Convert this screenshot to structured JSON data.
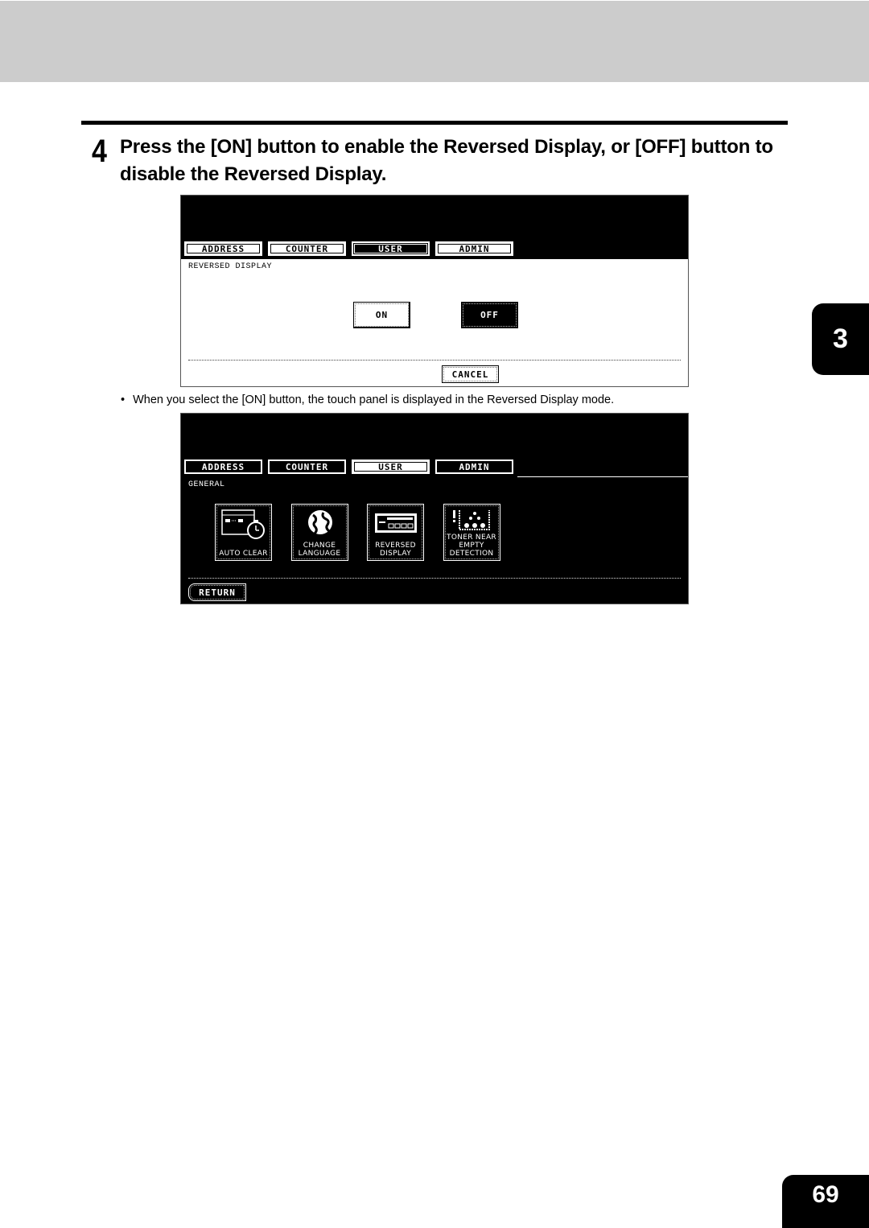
{
  "step": {
    "number": "4",
    "text": "Press the [ON] button to enable the Reversed Display, or [OFF] button to disable the Reversed Display."
  },
  "panel1": {
    "tabs": [
      {
        "label": "ADDRESS",
        "active": false
      },
      {
        "label": "COUNTER",
        "active": false
      },
      {
        "label": "USER",
        "active": true
      },
      {
        "label": "ADMIN",
        "active": false
      }
    ],
    "section_label": "REVERSED DISPLAY",
    "on_label": "ON",
    "off_label": "OFF",
    "selected": "OFF",
    "cancel_label": "CANCEL"
  },
  "note": {
    "bullet": "•",
    "text": "When you select the [ON] button, the touch panel is displayed in the Reversed Display mode."
  },
  "panel2": {
    "tabs": [
      {
        "label": "ADDRESS",
        "active": false
      },
      {
        "label": "COUNTER",
        "active": false
      },
      {
        "label": "USER",
        "active": true
      },
      {
        "label": "ADMIN",
        "active": false
      }
    ],
    "section_label": "GENERAL",
    "icons": [
      {
        "label": "AUTO CLEAR",
        "icon": "timer-window-icon"
      },
      {
        "label": "CHANGE LANGUAGE",
        "icon": "globe-icon"
      },
      {
        "label": "REVERSED DISPLAY",
        "icon": "display-panel-icon"
      },
      {
        "label": "TONER NEAR EMPTY DETECTION",
        "icon": "toner-warning-icon"
      }
    ],
    "return_label": "RETURN"
  },
  "chapter_tab": "3",
  "page_number": "69",
  "colors": {
    "header_band": "#cccccc",
    "ink": "#000000",
    "paper": "#ffffff"
  }
}
